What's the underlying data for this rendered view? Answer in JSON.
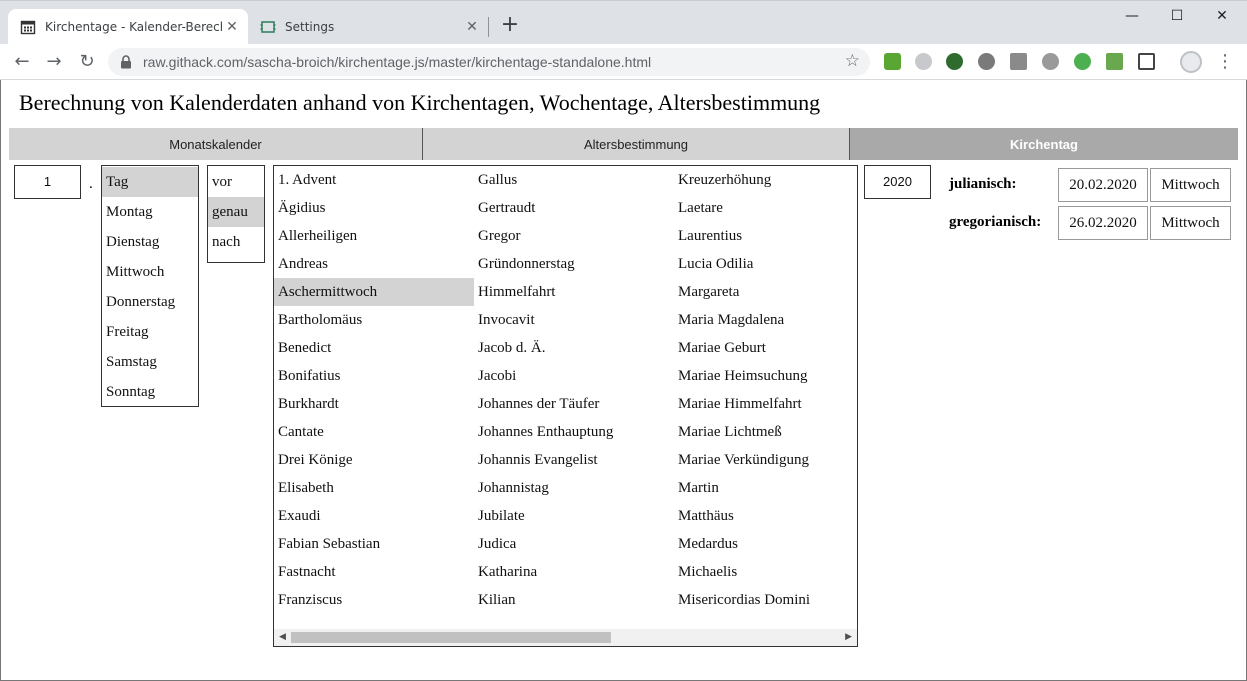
{
  "browser": {
    "tabs": [
      {
        "title": "Kirchentage - Kalender-Berechnu",
        "icon": "calendar-icon",
        "active": true
      },
      {
        "title": "Settings",
        "icon": "settings-icon",
        "active": false
      }
    ],
    "close_glyph": "✕",
    "new_tab_glyph": "+",
    "window_controls": {
      "minimize": "—",
      "maximize": "☐",
      "close": "✕"
    },
    "url": "raw.githack.com/sascha-broich/kirchentage.js/master/kirchentage-standalone.html",
    "nav": {
      "back": "←",
      "forward": "→",
      "reload": "↻"
    },
    "star_glyph": "☆",
    "menu_glyph": "⋮"
  },
  "page": {
    "title": "Berechnung von Kalenderdaten anhand von Kirchentagen, Wochentage, Altersbestimmung",
    "nav_tabs": [
      "Monatskalender",
      "Altersbestimmung",
      "Kirchentag"
    ],
    "active_tab": "Kirchentag",
    "count_value": "1",
    "separator": ".",
    "weekday_options": [
      "Tag",
      "Montag",
      "Dienstag",
      "Mittwoch",
      "Donnerstag",
      "Freitag",
      "Samstag",
      "Sonntag"
    ],
    "weekday_selected": "Tag",
    "relation_options": [
      "vor",
      "genau",
      "nach"
    ],
    "relation_selected": "genau",
    "feast_columns": [
      [
        "1. Advent",
        "Ägidius",
        "Allerheiligen",
        "Andreas",
        "Aschermittwoch",
        "Bartholomäus",
        "Benedict",
        "Bonifatius",
        "Burkhardt",
        "Cantate",
        "Drei Könige",
        "Elisabeth",
        "Exaudi",
        "Fabian Sebastian",
        "Fastnacht",
        "Franziscus"
      ],
      [
        "Gallus",
        "Gertraudt",
        "Gregor",
        "Gründonnerstag",
        "Himmelfahrt",
        "Invocavit",
        "Jacob d. Ä.",
        "Jacobi",
        "Johannes der Täufer",
        "Johannes Enthauptung",
        "Johannis Evangelist",
        "Johannistag",
        "Jubilate",
        "Judica",
        "Katharina",
        "Kilian"
      ],
      [
        "Kreuzerhöhung",
        "Laetare",
        "Laurentius",
        "Lucia Odilia",
        "Margareta",
        "Maria Magdalena",
        "Mariae Geburt",
        "Mariae Heimsuchung",
        "Mariae Himmelfahrt",
        "Mariae Lichtmeß",
        "Mariae Verkündigung",
        "Martin",
        "Matthäus",
        "Medardus",
        "Michaelis",
        "Misericordias Domini"
      ]
    ],
    "feast_selected": "Aschermittwoch",
    "year_value": "2020",
    "results": [
      {
        "label": "julianisch:",
        "date": "20.02.2020",
        "weekday": "Mittwoch"
      },
      {
        "label": "gregorianisch:",
        "date": "26.02.2020",
        "weekday": "Mittwoch"
      }
    ]
  }
}
